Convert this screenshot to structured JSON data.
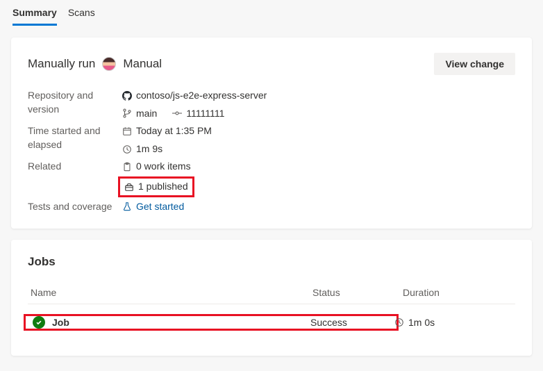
{
  "tabs": {
    "summary": "Summary",
    "scans": "Scans"
  },
  "summary": {
    "title_prefix": "Manually run",
    "title_suffix": "Manual",
    "view_change_label": "View change",
    "labels": {
      "repo": "Repository and version",
      "time": "Time started and elapsed",
      "related": "Related",
      "tests": "Tests and coverage"
    },
    "repo_name": "contoso/js-e2e-express-server",
    "branch": "main",
    "commit": "11111111",
    "started": "Today at 1:35 PM",
    "elapsed": "1m 9s",
    "work_items": "0 work items",
    "published": "1 published",
    "get_started": "Get started"
  },
  "jobs": {
    "heading": "Jobs",
    "columns": {
      "name": "Name",
      "status": "Status",
      "duration": "Duration"
    },
    "rows": [
      {
        "name": "Job",
        "status": "Success",
        "duration": "1m 0s"
      }
    ]
  }
}
